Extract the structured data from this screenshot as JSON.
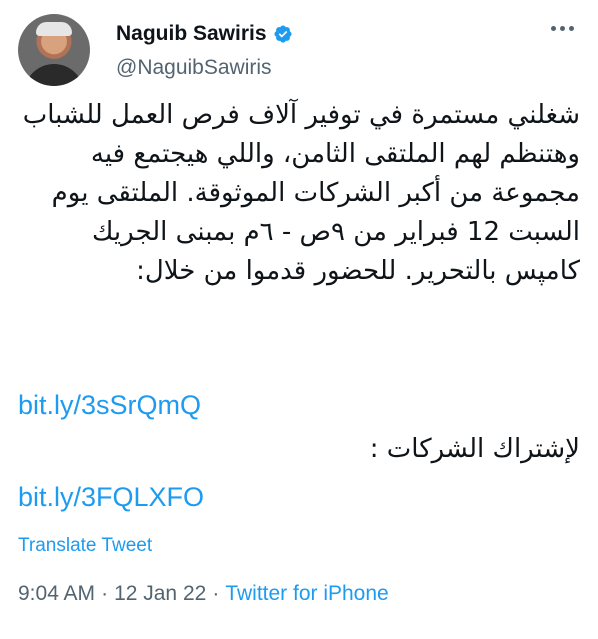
{
  "author": {
    "name": "Naguib Sawiris",
    "handle": "@NaguibSawiris"
  },
  "tweet": {
    "text": "شغلني مستمرة في توفير آلاف فرص العمل للشباب وهتنظم لهم الملتقى الثامن، واللي هيجتمع فيه مجموعة من أكبر الشركات الموثوقة. الملتقى يوم السبت 12 فبراير من ٩ص - ٦م بمبنى الجريك كامپس بالتحرير. للحضور قدموا من خلال:",
    "link1": "bit.ly/3sSrQmQ",
    "line_companies": "لإشتراك الشركات :",
    "link2": "bit.ly/3FQLXFO"
  },
  "translate_label": "Translate Tweet",
  "meta": {
    "time": "9:04 AM",
    "sep1": "·",
    "date": "12 Jan 22",
    "sep2": "·",
    "source": "Twitter for iPhone"
  },
  "colors": {
    "link": "#1d9bf0",
    "secondary": "#536471",
    "text": "#0f1419"
  },
  "icons": {
    "verified": "verified-badge-icon",
    "more": "more-options-icon"
  }
}
